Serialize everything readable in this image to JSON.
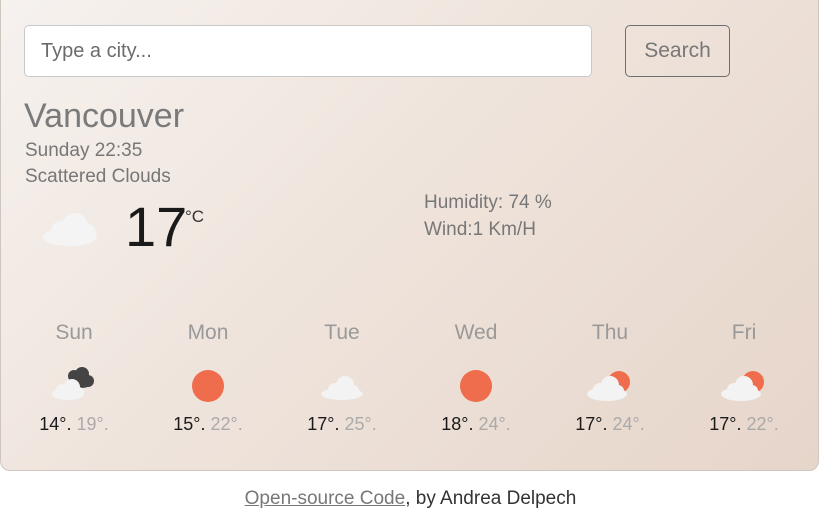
{
  "search": {
    "placeholder": "Type a city...",
    "button_label": "Search"
  },
  "current": {
    "city": "Vancouver",
    "datetime": "Sunday 22:35",
    "condition": "Scattered Clouds",
    "icon": "cloud-icon",
    "temperature": "17",
    "unit": "°C",
    "humidity": "Humidity: 74 %",
    "wind": "Wind:1 Km/H"
  },
  "forecast": [
    {
      "day": "Sun",
      "min": "14°.",
      "max": "19°.",
      "icon": "broken-clouds-icon"
    },
    {
      "day": "Mon",
      "min": "15°.",
      "max": "22°.",
      "icon": "sun-icon"
    },
    {
      "day": "Tue",
      "min": "17°.",
      "max": "25°.",
      "icon": "cloud-icon"
    },
    {
      "day": "Wed",
      "min": "18°.",
      "max": "24°.",
      "icon": "sun-icon"
    },
    {
      "day": "Thu",
      "min": "17°.",
      "max": "24°.",
      "icon": "partly-cloudy-icon"
    },
    {
      "day": "Fri",
      "min": "17°.",
      "max": "22°.",
      "icon": "partly-cloudy-icon"
    }
  ],
  "footer": {
    "link_text": "Open-source Code",
    "suffix": ", by Andrea Delpech"
  },
  "colors": {
    "sun": "#ef6c4c",
    "cloud": "#f3f3f3",
    "dark_cloud": "#444444"
  }
}
